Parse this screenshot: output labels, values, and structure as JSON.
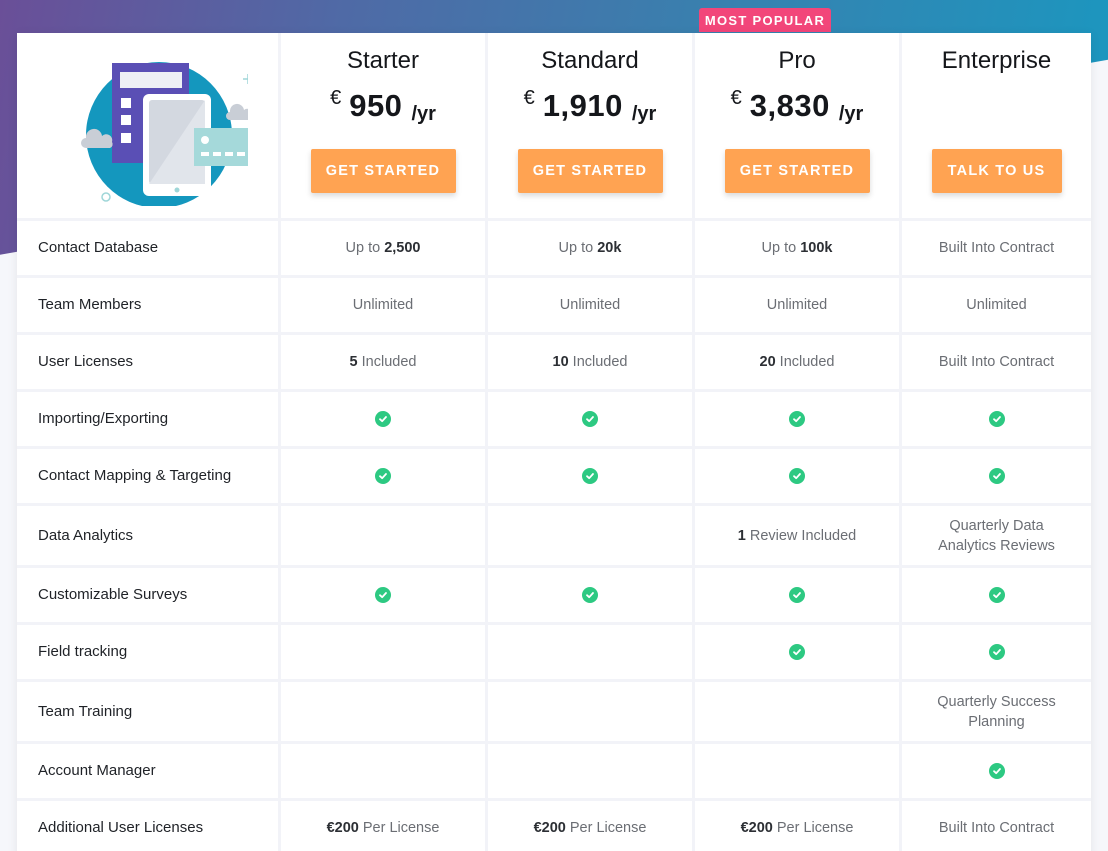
{
  "badge": "MOST POPULAR",
  "plans": [
    {
      "name": "Starter",
      "currency": "€",
      "amount": "950",
      "period": "/yr",
      "cta": "GET STARTED"
    },
    {
      "name": "Standard",
      "currency": "€",
      "amount": "1,910",
      "period": "/yr",
      "cta": "GET STARTED"
    },
    {
      "name": "Pro",
      "currency": "€",
      "amount": "3,830",
      "period": "/yr",
      "cta": "GET STARTED"
    },
    {
      "name": "Enterprise",
      "currency": "",
      "amount": "",
      "period": "",
      "cta": "TALK TO US"
    }
  ],
  "colors": {
    "cta": "#ffa352",
    "badge": "#f2467a",
    "check": "#2dc982"
  },
  "features": [
    {
      "label": "Contact Database",
      "values": [
        {
          "pre": "Up to ",
          "bold": "2,500",
          "post": ""
        },
        {
          "pre": "Up to ",
          "bold": "20k",
          "post": ""
        },
        {
          "pre": "Up to ",
          "bold": "100k",
          "post": ""
        },
        {
          "text": "Built Into Contract"
        }
      ]
    },
    {
      "label": "Team Members",
      "values": [
        {
          "text": "Unlimited"
        },
        {
          "text": "Unlimited"
        },
        {
          "text": "Unlimited"
        },
        {
          "text": "Unlimited"
        }
      ]
    },
    {
      "label": "User Licenses",
      "values": [
        {
          "pre": "",
          "bold": "5",
          "post": " Included"
        },
        {
          "pre": "",
          "bold": "10",
          "post": " Included"
        },
        {
          "pre": "",
          "bold": "20",
          "post": " Included"
        },
        {
          "text": "Built Into Contract"
        }
      ]
    },
    {
      "label": "Importing/Exporting",
      "values": [
        {
          "check": true
        },
        {
          "check": true
        },
        {
          "check": true
        },
        {
          "check": true
        }
      ]
    },
    {
      "label": "Contact Mapping & Targeting",
      "values": [
        {
          "check": true
        },
        {
          "check": true
        },
        {
          "check": true
        },
        {
          "check": true
        }
      ]
    },
    {
      "label": "Data Analytics",
      "tall": true,
      "values": [
        {},
        {},
        {
          "pre": "",
          "bold": "1",
          "post": " Review Included"
        },
        {
          "lines": [
            "Quarterly Data",
            "Analytics Reviews"
          ]
        }
      ]
    },
    {
      "label": "Customizable Surveys",
      "values": [
        {
          "check": true
        },
        {
          "check": true
        },
        {
          "check": true
        },
        {
          "check": true
        }
      ]
    },
    {
      "label": "Field tracking",
      "values": [
        {},
        {},
        {
          "check": true
        },
        {
          "check": true
        }
      ]
    },
    {
      "label": "Team Training",
      "tall": true,
      "values": [
        {},
        {},
        {},
        {
          "lines": [
            "Quarterly Success",
            "Planning"
          ]
        }
      ]
    },
    {
      "label": "Account Manager",
      "values": [
        {},
        {},
        {},
        {
          "check": true
        }
      ]
    },
    {
      "label": "Additional User Licenses",
      "values": [
        {
          "pre": "",
          "bold": "€200",
          "post": " Per License"
        },
        {
          "pre": "",
          "bold": "€200",
          "post": " Per License"
        },
        {
          "pre": "",
          "bold": "€200",
          "post": " Per License"
        },
        {
          "text": "Built Into Contract"
        }
      ]
    }
  ]
}
